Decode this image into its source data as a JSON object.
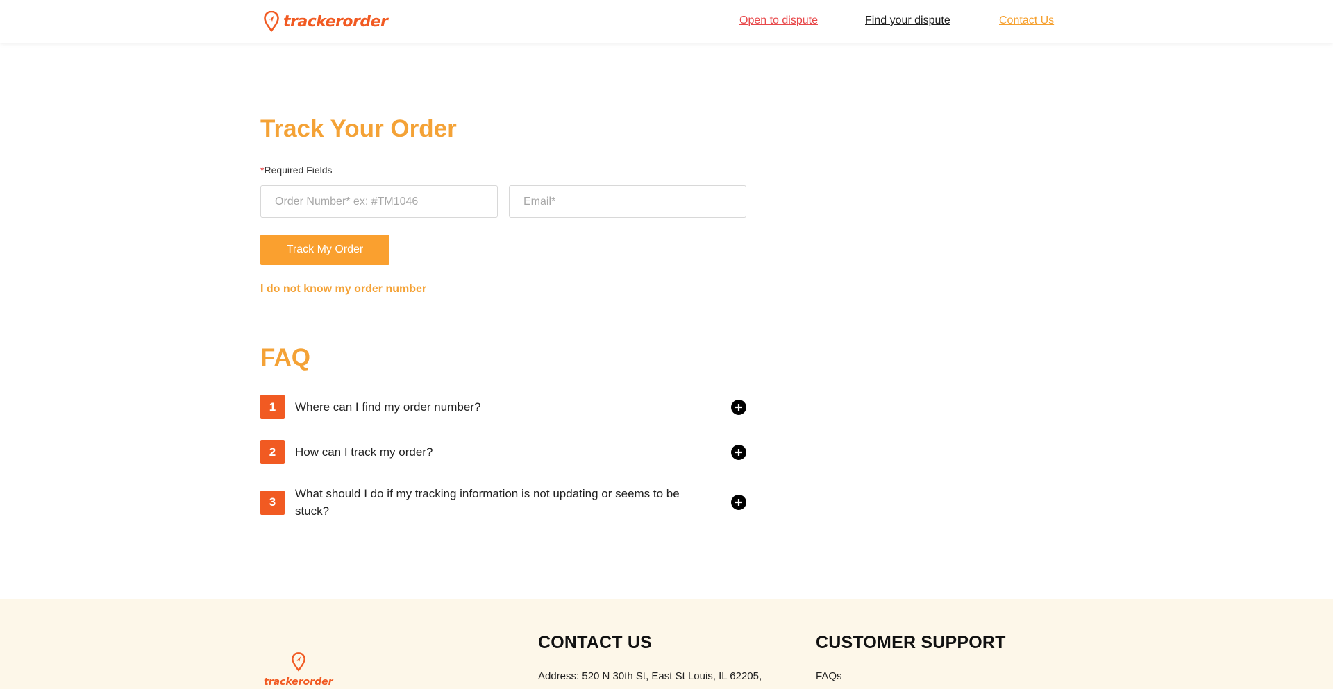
{
  "header": {
    "logo_text": "trackerorder",
    "nav": {
      "open_dispute": "Open to dispute",
      "find_dispute": "Find your dispute",
      "contact_us": "Contact Us"
    }
  },
  "main": {
    "title": "Track Your Order",
    "required_star": "*",
    "required_label": "Required Fields",
    "order_field": {
      "placeholder": "Order Number* ex: #TM1046",
      "value": ""
    },
    "email_field": {
      "placeholder": "Email*",
      "value": ""
    },
    "track_button": "Track My Order",
    "no_order_link": "I do not know my order number"
  },
  "faq": {
    "title": "FAQ",
    "items": [
      {
        "num": "1",
        "question": "Where can I find my order number?"
      },
      {
        "num": "2",
        "question": "How can I track my order?"
      },
      {
        "num": "3",
        "question": "What should I do if my tracking information is not updating or seems to be stuck?"
      }
    ]
  },
  "footer": {
    "logo_text": "trackerorder",
    "contact_heading": "CONTACT US",
    "address": "Address: 520 N 30th St, East St Louis, IL 62205,",
    "support_heading": "CUSTOMER SUPPORT",
    "faqs_link": "FAQs"
  },
  "colors": {
    "accent": "#f4a236",
    "brand": "#f15a22",
    "dispute": "#e8484a",
    "footer_bg": "#fdf7e9"
  },
  "icons": {
    "logo": "location-pin-icon",
    "faq_toggle": "plus-circle-icon"
  }
}
